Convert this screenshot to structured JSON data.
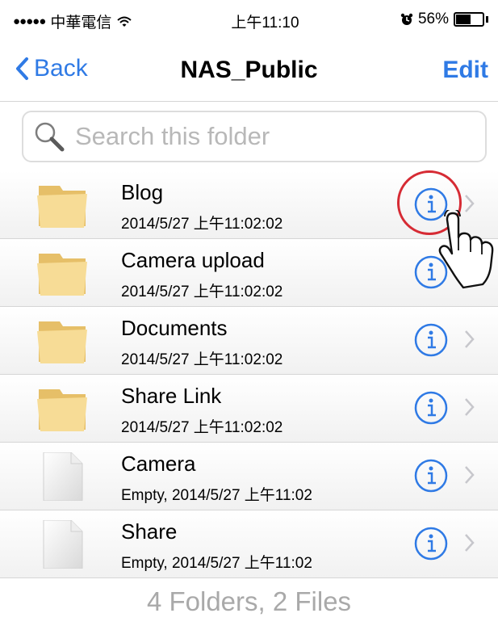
{
  "status_bar": {
    "carrier": "中華電信",
    "time": "上午11:10",
    "battery_percent": "56%",
    "battery_level": 0.56,
    "signal_icon": "signal-dots-icon",
    "wifi_icon": "wifi-icon",
    "alarm_icon": "alarm-icon"
  },
  "nav": {
    "back_label": "Back",
    "title": "NAS_Public",
    "edit_label": "Edit"
  },
  "search": {
    "placeholder": "Search this folder",
    "value": ""
  },
  "items": [
    {
      "type": "folder",
      "name": "Blog",
      "subtitle": "2014/5/27 上午11:02:02"
    },
    {
      "type": "folder",
      "name": "Camera upload",
      "subtitle": "2014/5/27 上午11:02:02"
    },
    {
      "type": "folder",
      "name": "Documents",
      "subtitle": "2014/5/27 上午11:02:02"
    },
    {
      "type": "folder",
      "name": "Share Link",
      "subtitle": "2014/5/27 上午11:02:02"
    },
    {
      "type": "file",
      "name": "Camera",
      "subtitle": "Empty, 2014/5/27 上午11:02"
    },
    {
      "type": "file",
      "name": "Share",
      "subtitle": "Empty, 2014/5/27 上午11:02"
    }
  ],
  "summary": "4 Folders, 2 Files",
  "colors": {
    "accent": "#2f7ae5",
    "highlight": "#d62b34",
    "folder": "#f5d589"
  }
}
